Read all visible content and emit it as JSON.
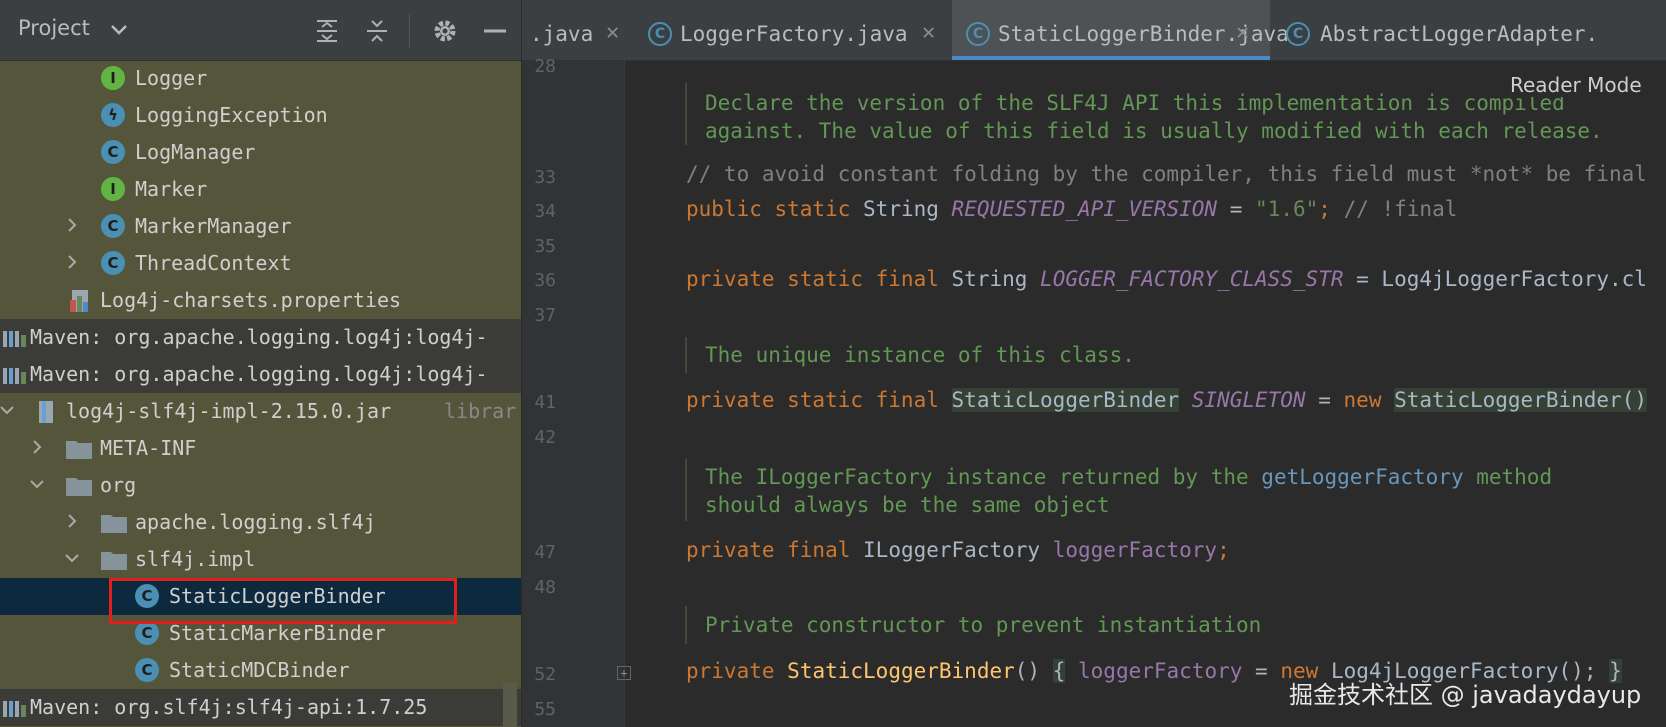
{
  "project_panel": {
    "title": "Project",
    "header_icons": [
      "expand-all-icon",
      "collapse-all-icon",
      "gear-icon",
      "minimize-icon"
    ],
    "tree": [
      {
        "label": "Logger",
        "icon": "interface-icon"
      },
      {
        "label": "LoggingException",
        "icon": "exception-class-icon"
      },
      {
        "label": "LogManager",
        "icon": "class-icon"
      },
      {
        "label": "Marker",
        "icon": "interface-icon"
      },
      {
        "label": "MarkerManager",
        "icon": "class-icon",
        "arrow": "collapsed"
      },
      {
        "label": "ThreadContext",
        "icon": "class-icon",
        "arrow": "collapsed"
      },
      {
        "label": "Log4j-charsets.properties",
        "icon": "properties-file-icon"
      },
      {
        "label": "Maven: org.apache.logging.log4j:log4j-",
        "icon": "library-icon"
      },
      {
        "label": "Maven: org.apache.logging.log4j:log4j-",
        "icon": "library-icon"
      },
      {
        "label": "log4j-slf4j-impl-2.15.0.jar",
        "suffix": "librar",
        "icon": "jar-icon",
        "arrow": "expanded"
      },
      {
        "label": "META-INF",
        "icon": "folder-icon",
        "arrow": "collapsed"
      },
      {
        "label": "org",
        "icon": "folder-icon",
        "arrow": "expanded"
      },
      {
        "label": "apache.logging.slf4j",
        "icon": "folder-icon",
        "arrow": "collapsed"
      },
      {
        "label": "slf4j.impl",
        "icon": "folder-icon",
        "arrow": "expanded"
      },
      {
        "label": "StaticLoggerBinder",
        "icon": "class-icon",
        "selected": true
      },
      {
        "label": "StaticMarkerBinder",
        "icon": "class-icon"
      },
      {
        "label": "StaticMDCBinder",
        "icon": "class-icon"
      },
      {
        "label": "Maven: org.slf4j:slf4j-api:1.7.25",
        "icon": "library-icon"
      }
    ]
  },
  "tabs": [
    {
      "label": ".java",
      "active": false
    },
    {
      "label": "LoggerFactory.java",
      "active": false
    },
    {
      "label": "StaticLoggerBinder.java",
      "active": true
    },
    {
      "label": "AbstractLoggerAdapter.",
      "active": false
    }
  ],
  "editor": {
    "reader_mode_label": "Reader Mode",
    "line_numbers": [
      "28",
      "33",
      "34",
      "35",
      "36",
      "37",
      "41",
      "42",
      "47",
      "48",
      "52",
      "55"
    ],
    "doc_1_line_1": "Declare the version of the SLF4J API this implementation is compiled",
    "doc_1_line_2": "against. The value of this field is usually modified with each release.",
    "line_33": "// to avoid constant folding by the compiler, this field must *not* be final",
    "line_34": {
      "kw": "public static",
      "type": "String",
      "field": "REQUESTED_API_VERSION",
      "eq": "=",
      "str": "\"1.6\"",
      "semi": ";",
      "comment": "// !final"
    },
    "line_36": {
      "kw": "private static final",
      "type": "String",
      "field": "LOGGER_FACTORY_CLASS_STR",
      "rest": "= Log4jLoggerFactory.cl"
    },
    "doc_2": "The unique instance of this class.",
    "line_41": {
      "kw": "private static final",
      "type": "StaticLoggerBinder",
      "field": "SINGLETON",
      "eq": "=",
      "new": "new",
      "ctor": "StaticLoggerBinder()"
    },
    "doc_3_line_1_a": "The ILoggerFactory instance returned by the ",
    "doc_3_link": "getLoggerFactory",
    "doc_3_line_1_b": " method",
    "doc_3_line_2": "should always be the same object",
    "line_47": {
      "kw": "private final",
      "type": "ILoggerFactory",
      "field": "loggerFactory",
      "semi": ";"
    },
    "doc_4": "Private constructor to prevent instantiation",
    "line_52": {
      "kw": "private",
      "method": "StaticLoggerBinder",
      "parens": "()",
      "open": "{",
      "field": "loggerFactory",
      "eq": "=",
      "new": "new",
      "ctor": "Log4jLoggerFactory();",
      "close": "}"
    }
  },
  "watermark": "掘金技术社区 @ javadaydayup"
}
